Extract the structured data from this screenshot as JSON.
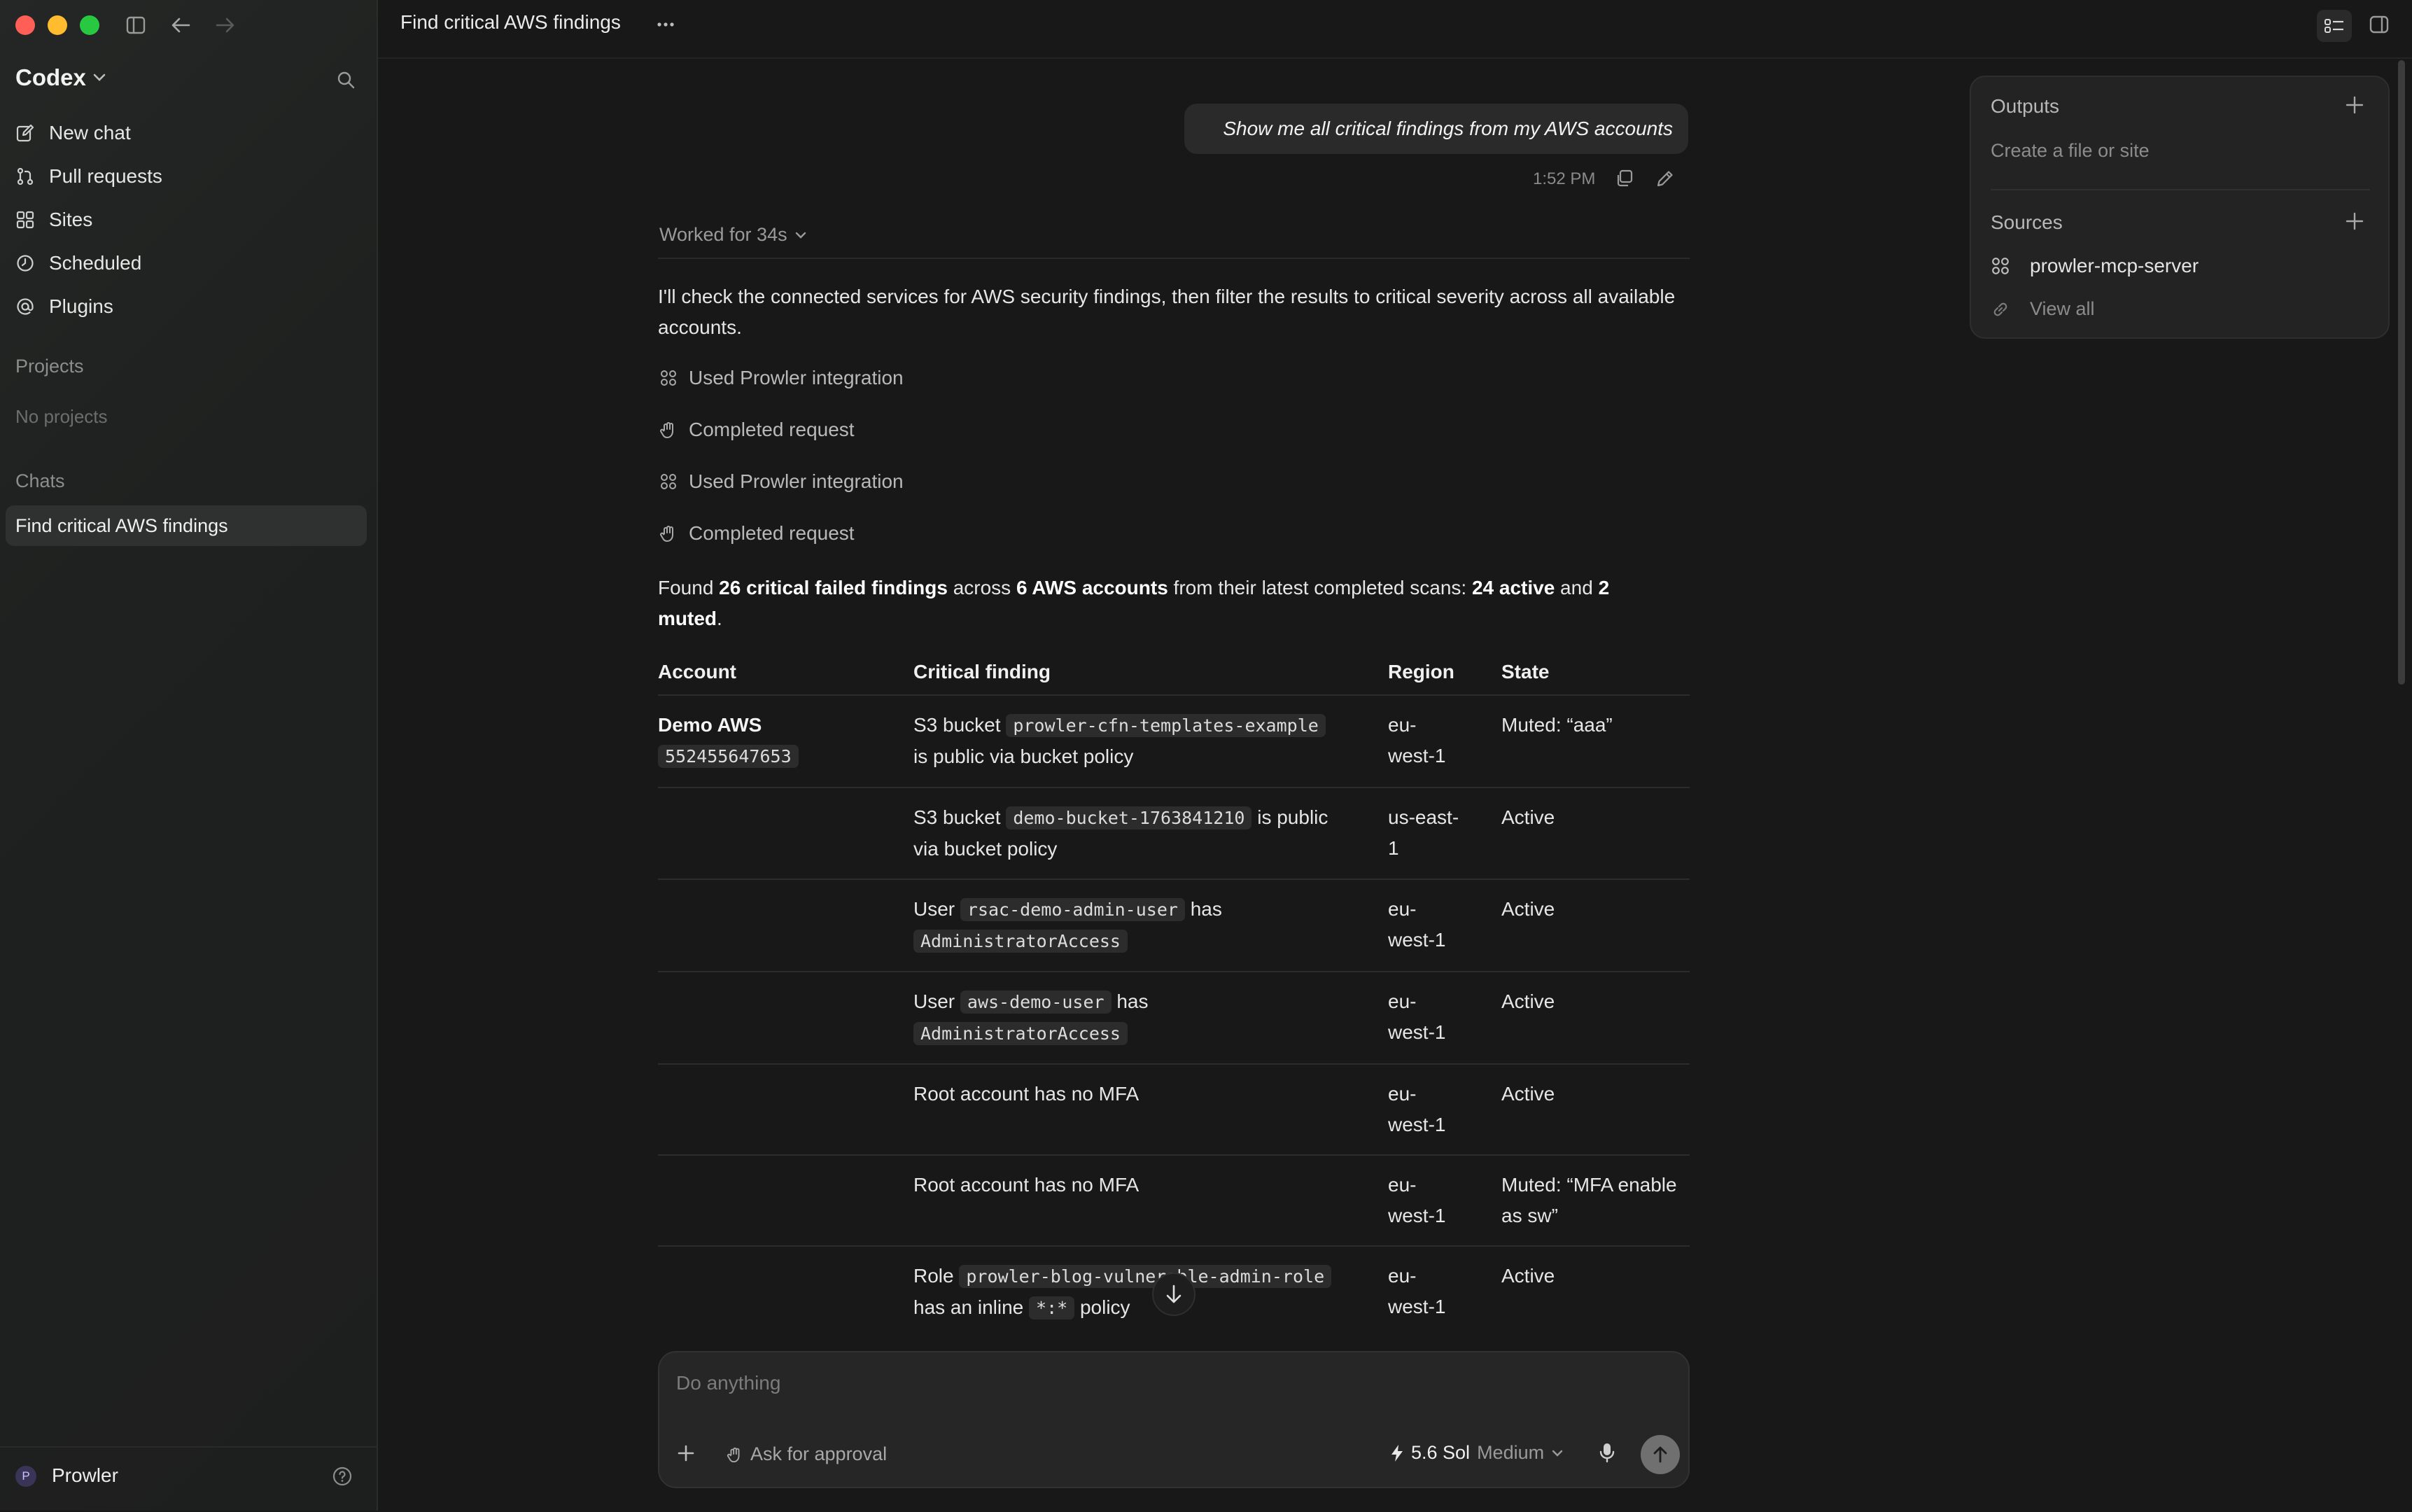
{
  "window": {
    "title": "Find critical AWS findings"
  },
  "sidebar": {
    "brand": "Codex",
    "nav": [
      {
        "label": "New chat",
        "icon": "edit-icon"
      },
      {
        "label": "Pull requests",
        "icon": "pull-request-icon"
      },
      {
        "label": "Sites",
        "icon": "grid-icon"
      },
      {
        "label": "Scheduled",
        "icon": "clock-icon"
      },
      {
        "label": "Plugins",
        "icon": "at-icon"
      }
    ],
    "projects_label": "Projects",
    "no_projects": "No projects",
    "chats_label": "Chats",
    "active_chat": "Find critical AWS findings",
    "account": {
      "initial": "P",
      "name": "Prowler"
    }
  },
  "conversation": {
    "user_message": "Show me all critical findings from my AWS accounts",
    "timestamp": "1:52 PM",
    "worked": "Worked for 34s",
    "intro": "I'll check the connected services for AWS security findings, then filter the results to critical severity across all available accounts.",
    "steps": [
      {
        "label": "Used Prowler integration",
        "icon": "integration-icon"
      },
      {
        "label": "Completed request",
        "icon": "hand-icon"
      },
      {
        "label": "Used Prowler integration",
        "icon": "integration-icon"
      },
      {
        "label": "Completed request",
        "icon": "hand-icon"
      }
    ],
    "summary": {
      "p1": "Found ",
      "b1": "26 critical failed findings",
      "p2": " across ",
      "b2": "6 AWS accounts",
      "p3": " from their latest completed scans: ",
      "b3": "24 active",
      "p4": " and ",
      "b4": "2",
      "b5": "muted",
      "p5": "."
    }
  },
  "table": {
    "headers": {
      "account": "Account",
      "finding": "Critical finding",
      "region": "Region",
      "state": "State"
    },
    "account_name": "Demo AWS",
    "account_id": "552455647653",
    "rows": [
      {
        "pre": "S3 bucket ",
        "code": "prowler-cfn-templates-example",
        "post": "",
        "line2": "is public via bucket policy",
        "region1": "eu-",
        "region2": "west-1",
        "state1": "Muted: “aaa”",
        "state2": ""
      },
      {
        "pre": "S3 bucket ",
        "code": "demo-bucket-1763841210",
        "post": " is public",
        "line2": "via bucket policy",
        "region1": "us-east-",
        "region2": "1",
        "state1": "Active",
        "state2": ""
      },
      {
        "pre": "User ",
        "code": "rsac-demo-admin-user",
        "post": " has",
        "code2": "AdministratorAccess",
        "region1": "eu-",
        "region2": "west-1",
        "state1": "Active",
        "state2": ""
      },
      {
        "pre": "User ",
        "code": "aws-demo-user",
        "post": " has",
        "code2": "AdministratorAccess",
        "region1": "eu-",
        "region2": "west-1",
        "state1": "Active",
        "state2": ""
      },
      {
        "pre": "Root account has no MFA",
        "region1": "eu-",
        "region2": "west-1",
        "state1": "Active",
        "state2": ""
      },
      {
        "pre": "Root account has no MFA",
        "region1": "eu-",
        "region2": "west-1",
        "state1": "Muted: “MFA enable",
        "state2": "as sw”"
      },
      {
        "pre": "Role ",
        "code": "prowler-blog-vulnerable-admin-role",
        "post": "",
        "line2pre": "has an inline ",
        "code2": "*:*",
        "line2post": " policy",
        "region1": "eu-",
        "region2": "west-1",
        "state1": "Active",
        "state2": ""
      }
    ]
  },
  "composer": {
    "placeholder": "Do anything",
    "approval": "Ask for approval",
    "model": "5.6 Sol",
    "effort": "Medium"
  },
  "panel": {
    "outputs_label": "Outputs",
    "outputs_sub": "Create a file or site",
    "sources_label": "Sources",
    "source_item": "prowler-mcp-server",
    "view_all": "View all"
  },
  "colors": {
    "background": "#181818",
    "sidebar": "#1f2120",
    "accent_text": "#ffffff"
  }
}
